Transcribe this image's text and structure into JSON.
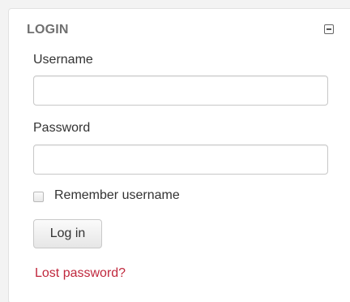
{
  "block": {
    "title": "LOGIN",
    "collapse_icon": "minus-square-icon"
  },
  "form": {
    "username_label": "Username",
    "username_value": "",
    "password_label": "Password",
    "password_value": "",
    "remember_label": "Remember username",
    "remember_checked": false,
    "login_button": "Log in",
    "lost_password_link": "Lost password?"
  },
  "colors": {
    "link": "#c0283d",
    "title": "#707070",
    "text": "#333333",
    "border": "#c8c8c8"
  }
}
